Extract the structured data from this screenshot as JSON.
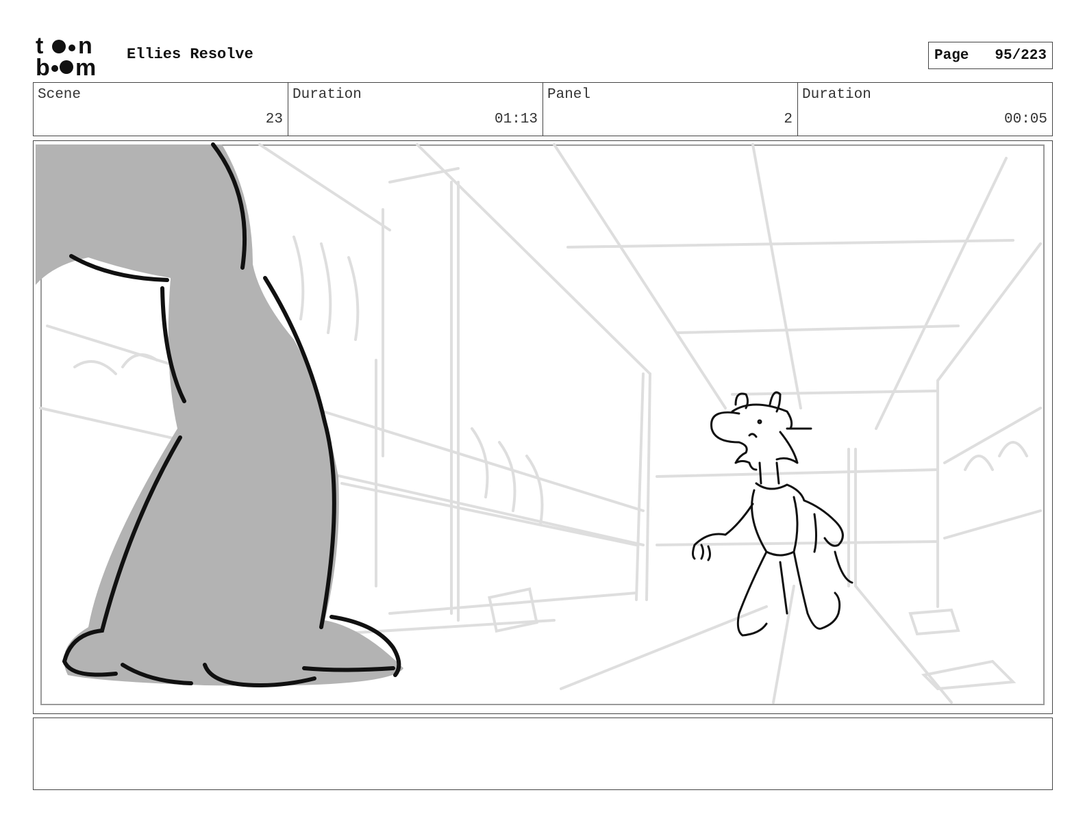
{
  "header": {
    "logo_text": "toon boom",
    "title": "Ellies Resolve",
    "page_label": "Page",
    "page_value": "95/223"
  },
  "info": {
    "scene_label": "Scene",
    "scene_value": "23",
    "scene_duration_label": "Duration",
    "scene_duration_value": "01:13",
    "panel_label": "Panel",
    "panel_value": "2",
    "panel_duration_label": "Duration",
    "panel_duration_value": "00:05"
  },
  "notes": {
    "text": ""
  }
}
